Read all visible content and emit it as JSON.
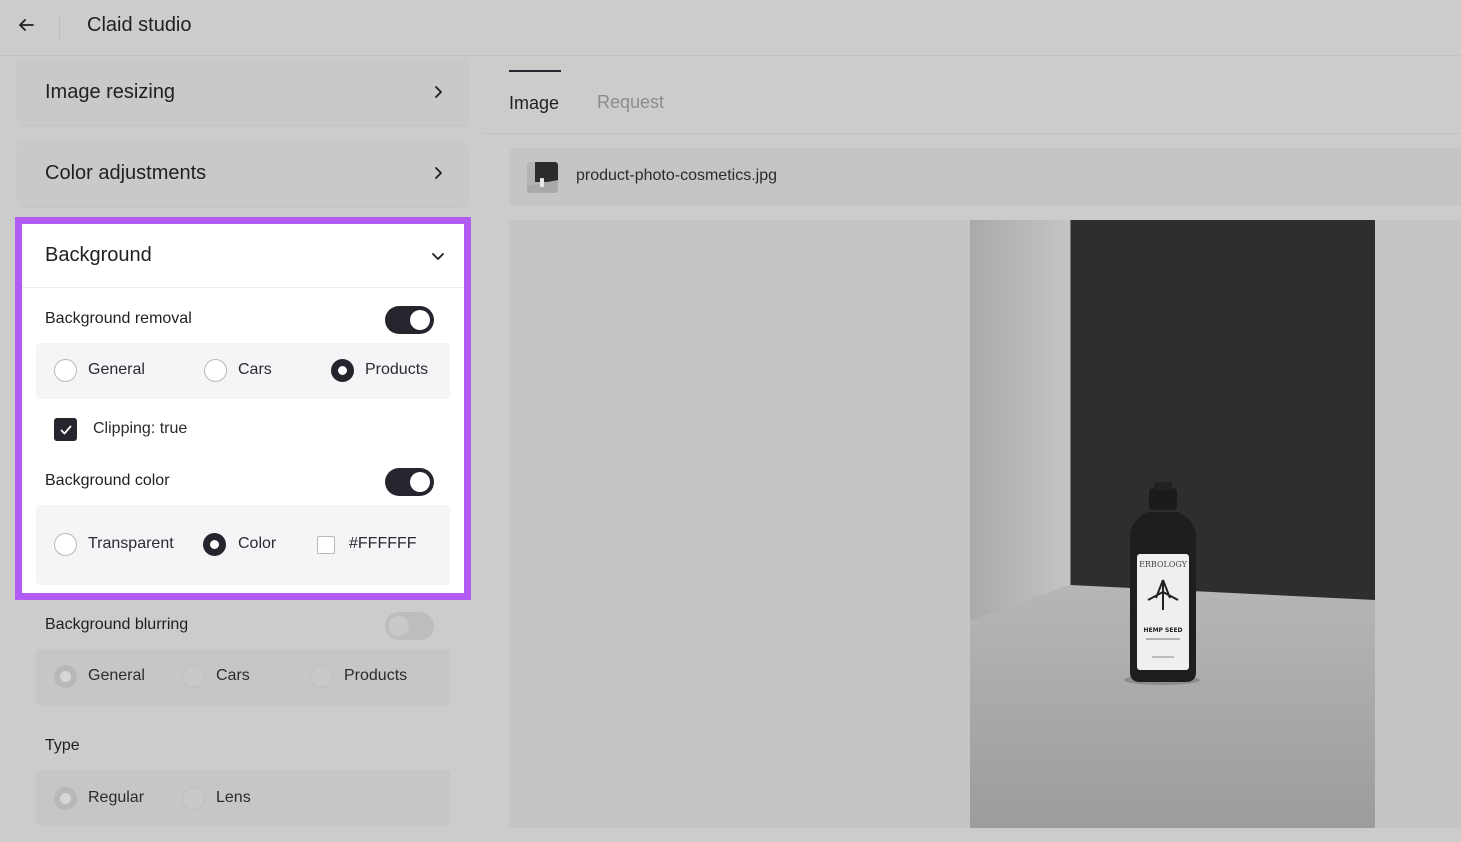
{
  "app": {
    "title": "Claid studio"
  },
  "sections": {
    "image_resizing": "Image resizing",
    "color_adjustments": "Color adjustments",
    "background": "Background"
  },
  "background": {
    "removal_label": "Background removal",
    "removal_enabled": true,
    "removal_options": [
      "General",
      "Cars",
      "Products"
    ],
    "removal_selected": "Products",
    "clipping_label": "Clipping: true",
    "clipping_checked": true,
    "color_label": "Background color",
    "color_enabled": true,
    "color_options": [
      "Transparent",
      "Color"
    ],
    "color_selected": "Color",
    "color_value": "#FFFFFF"
  },
  "blurring": {
    "label": "Background blurring",
    "enabled": false,
    "options": [
      "General",
      "Cars",
      "Products"
    ],
    "selected": "General",
    "type_label": "Type",
    "type_options": [
      "Regular",
      "Lens"
    ],
    "type_selected": "Regular"
  },
  "tabs": [
    {
      "label": "Image",
      "active": true
    },
    {
      "label": "Request",
      "active": false
    }
  ],
  "file": {
    "name": "product-photo-cosmetics.jpg"
  },
  "colors": {
    "accent_outline": "#b05cf5",
    "toggle_on": "#25252d"
  }
}
